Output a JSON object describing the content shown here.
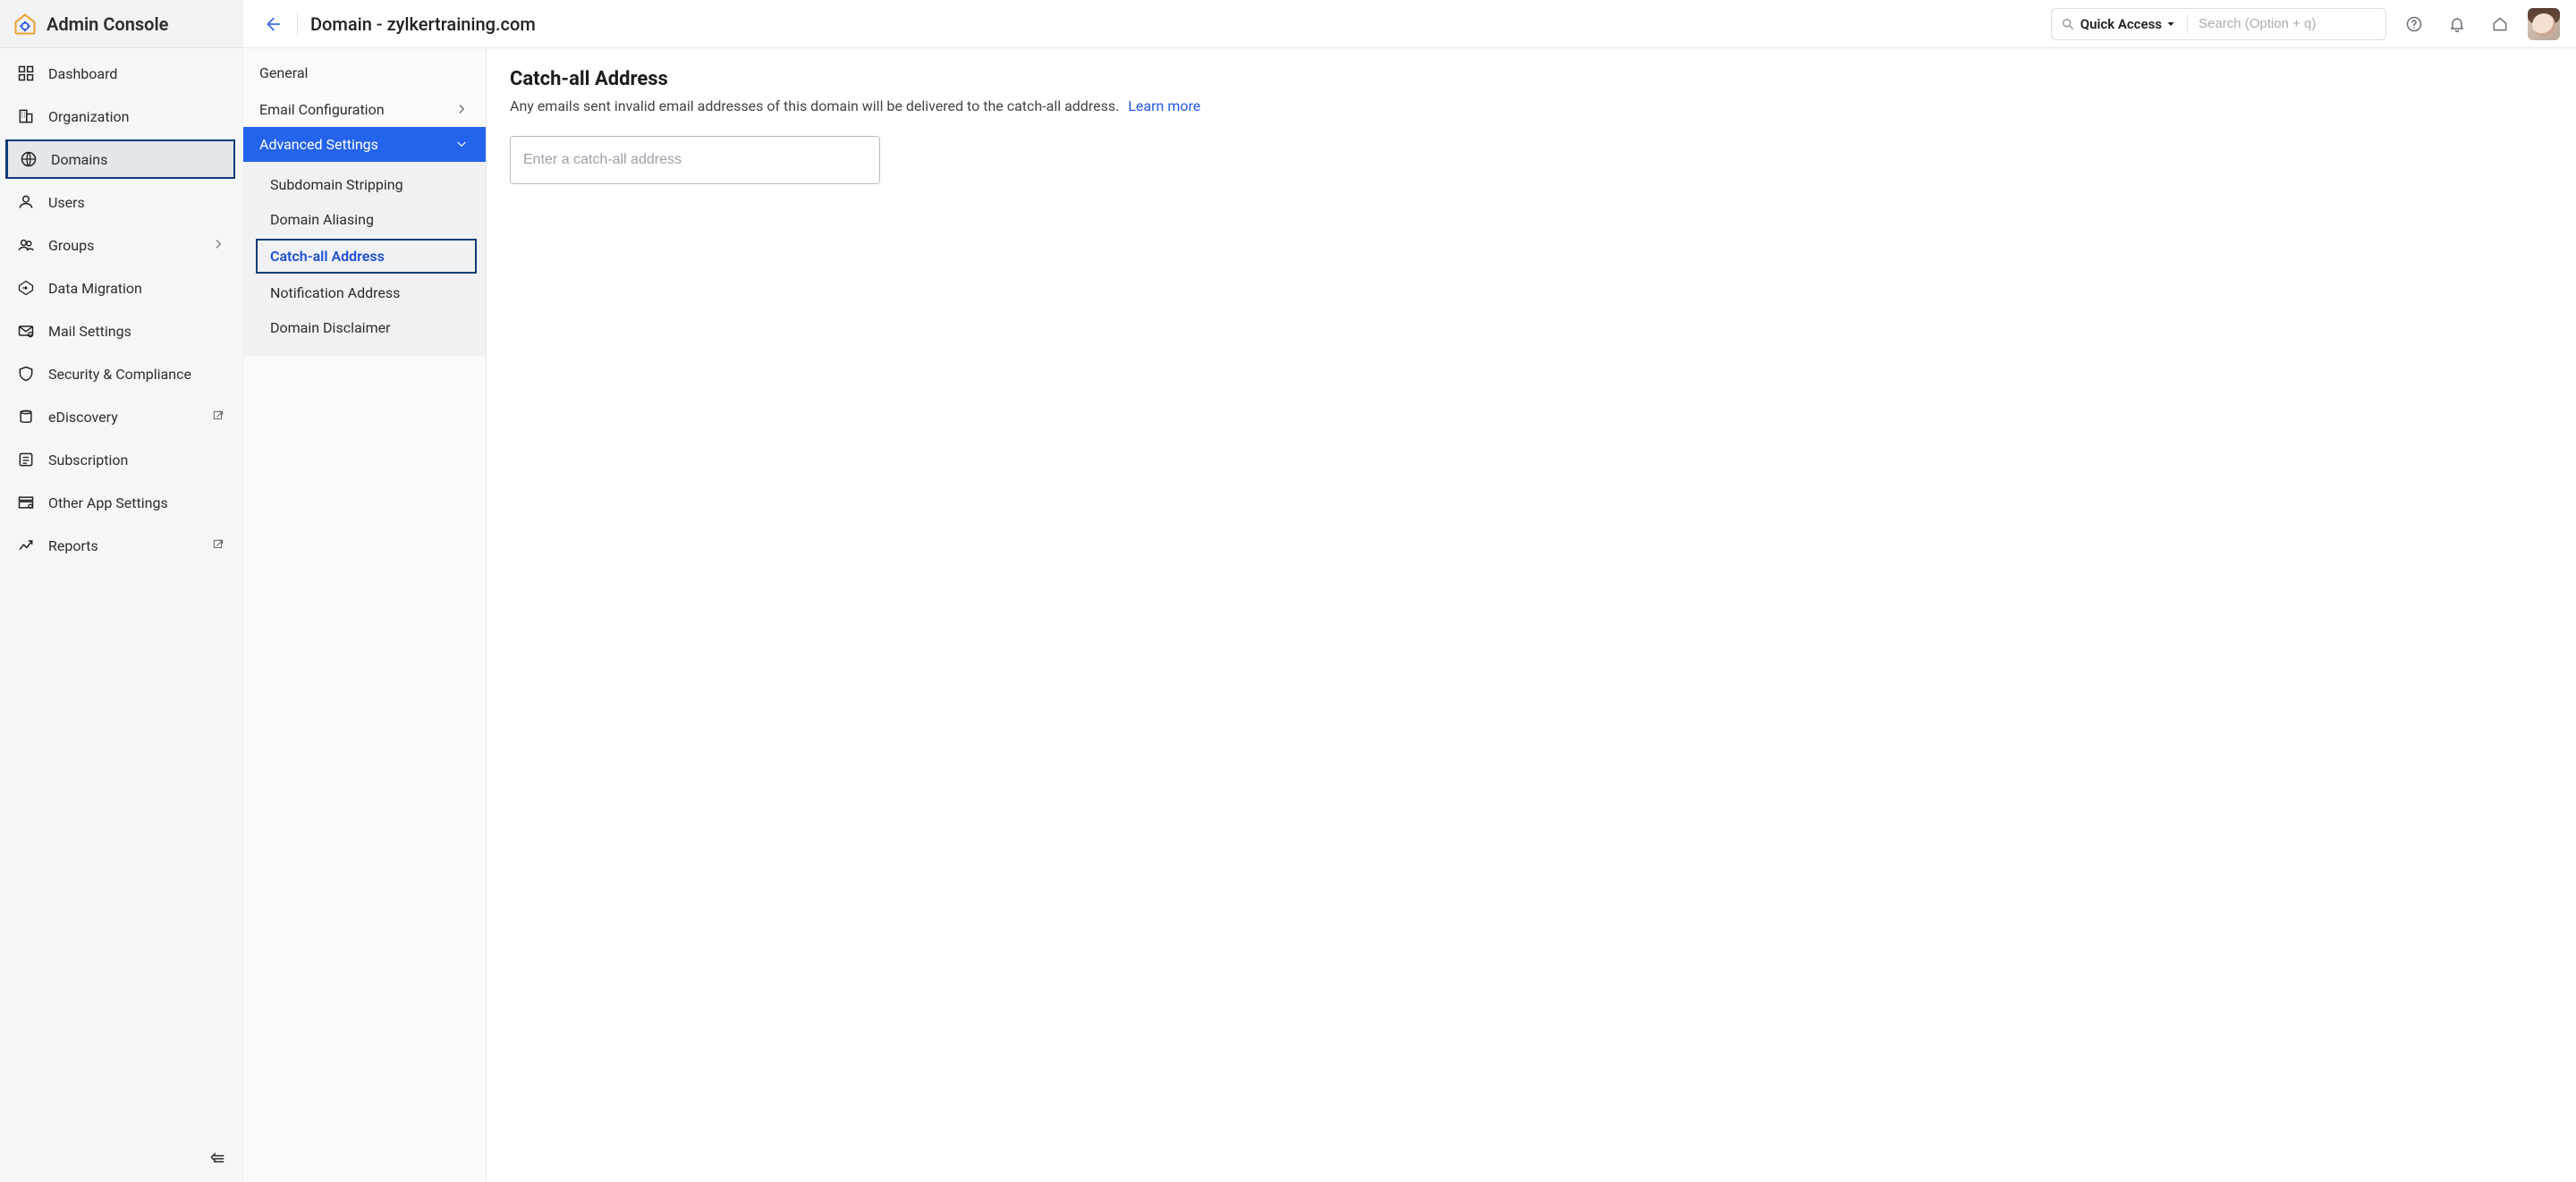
{
  "header": {
    "app_title": "Admin Console",
    "page_title": "Domain - zylkertraining.com",
    "quick_access_label": "Quick Access",
    "search_placeholder": "Search (Option + q)"
  },
  "sidebar": {
    "items": [
      {
        "label": "Dashboard",
        "icon": "dashboard-icon"
      },
      {
        "label": "Organization",
        "icon": "building-icon"
      },
      {
        "label": "Domains",
        "icon": "globe-icon",
        "active": true
      },
      {
        "label": "Users",
        "icon": "user-icon"
      },
      {
        "label": "Groups",
        "icon": "users-icon",
        "hasSubmenu": true
      },
      {
        "label": "Data Migration",
        "icon": "migration-icon"
      },
      {
        "label": "Mail Settings",
        "icon": "mail-settings-icon"
      },
      {
        "label": "Security & Compliance",
        "icon": "shield-icon"
      },
      {
        "label": "eDiscovery",
        "icon": "archive-icon",
        "external": true
      },
      {
        "label": "Subscription",
        "icon": "subscription-icon"
      },
      {
        "label": "Other App Settings",
        "icon": "apps-icon"
      },
      {
        "label": "Reports",
        "icon": "reports-icon",
        "external": true
      }
    ]
  },
  "settings_panel": {
    "items": [
      {
        "label": "General"
      },
      {
        "label": "Email Configuration",
        "hasSubmenu": true
      },
      {
        "label": "Advanced Settings",
        "expanded": true,
        "selected": true,
        "children": [
          {
            "label": "Subdomain Stripping"
          },
          {
            "label": "Domain Aliasing"
          },
          {
            "label": "Catch-all Address",
            "selected": true
          },
          {
            "label": "Notification Address"
          },
          {
            "label": "Domain Disclaimer"
          }
        ]
      }
    ]
  },
  "content": {
    "title": "Catch-all Address",
    "description": "Any emails sent invalid email addresses of this domain will be delivered to the catch-all address.",
    "learn_more": "Learn more",
    "input_placeholder": "Enter a catch-all address"
  }
}
